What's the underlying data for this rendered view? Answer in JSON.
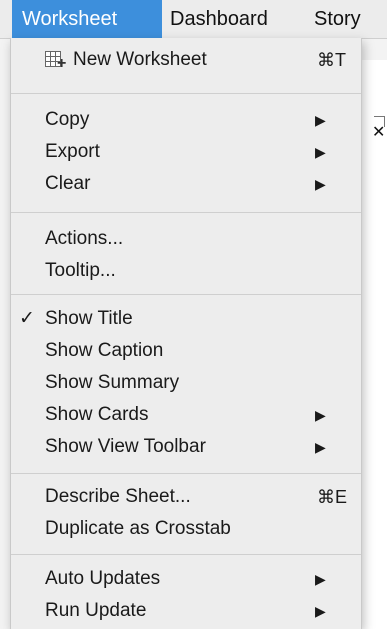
{
  "menubar": {
    "items": [
      {
        "label": "Worksheet",
        "active": true
      },
      {
        "label": "Dashboard",
        "active": false
      },
      {
        "label": "Story",
        "active": false
      }
    ]
  },
  "menu": {
    "new_worksheet": {
      "label": "New Worksheet",
      "shortcut": "⌘T",
      "icon": "new-worksheet-icon"
    },
    "copy": {
      "label": "Copy",
      "submenu": true
    },
    "export": {
      "label": "Export",
      "submenu": true
    },
    "clear": {
      "label": "Clear",
      "submenu": true
    },
    "actions": {
      "label": "Actions..."
    },
    "tooltip": {
      "label": "Tooltip..."
    },
    "show_title": {
      "label": "Show Title",
      "checked": true,
      "check_mark": "✓"
    },
    "show_caption": {
      "label": "Show Caption"
    },
    "show_summary": {
      "label": "Show Summary"
    },
    "show_cards": {
      "label": "Show Cards",
      "submenu": true
    },
    "show_view_toolbar": {
      "label": "Show View Toolbar",
      "submenu": true
    },
    "describe_sheet": {
      "label": "Describe Sheet...",
      "shortcut": "⌘E"
    },
    "duplicate_crosstab": {
      "label": "Duplicate as Crosstab"
    },
    "auto_updates": {
      "label": "Auto Updates",
      "submenu": true
    },
    "run_update": {
      "label": "Run Update",
      "submenu": true
    }
  },
  "colors": {
    "active_menu": "#3d8fdc",
    "menu_bg": "#ededed",
    "separator": "#cfcfcf"
  }
}
